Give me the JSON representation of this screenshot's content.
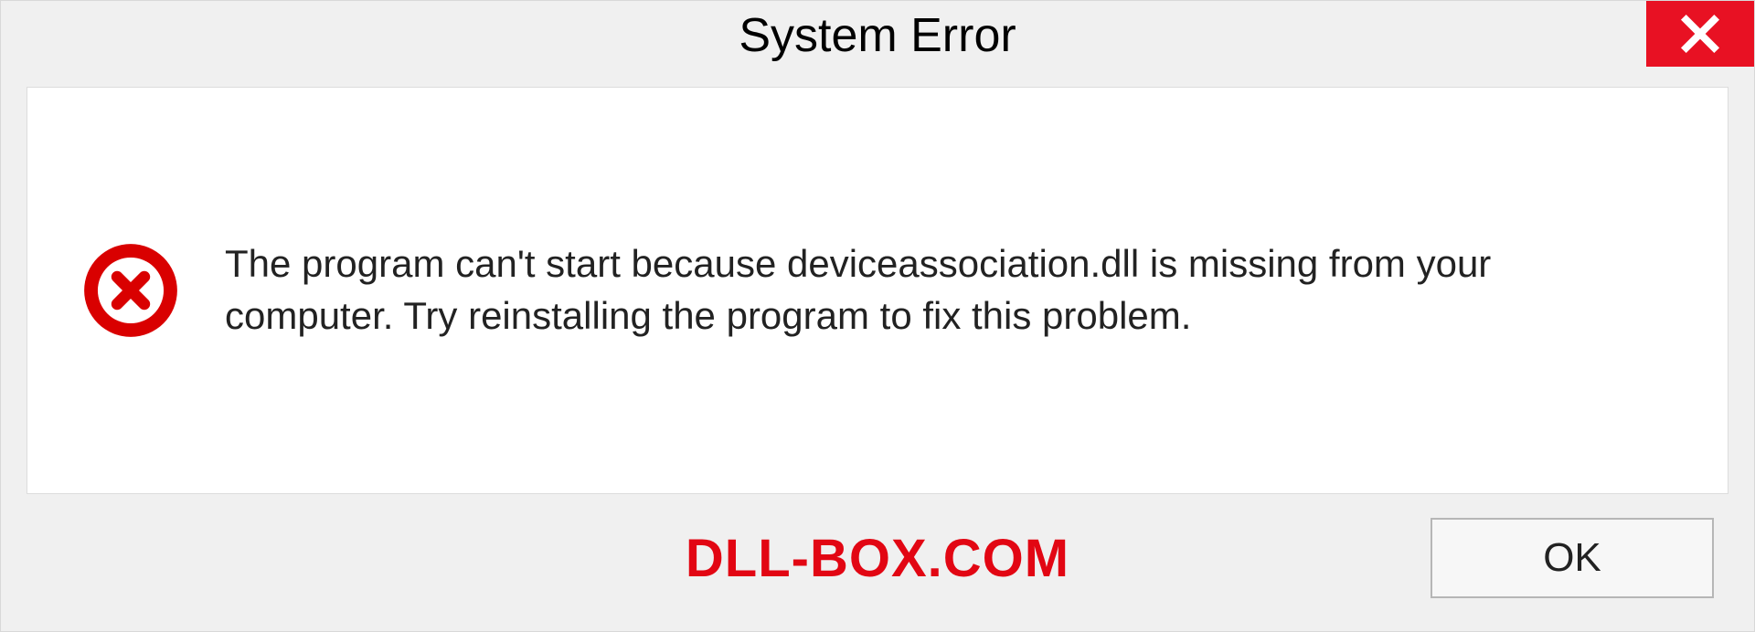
{
  "titlebar": {
    "title": "System Error"
  },
  "content": {
    "message": "The program can't start because deviceassociation.dll is missing from your computer. Try reinstalling the program to fix this problem."
  },
  "footer": {
    "watermark": "DLL-BOX.COM",
    "ok_label": "OK"
  },
  "colors": {
    "close_bg": "#e81123",
    "error_icon": "#d90000",
    "watermark": "#e20613"
  }
}
